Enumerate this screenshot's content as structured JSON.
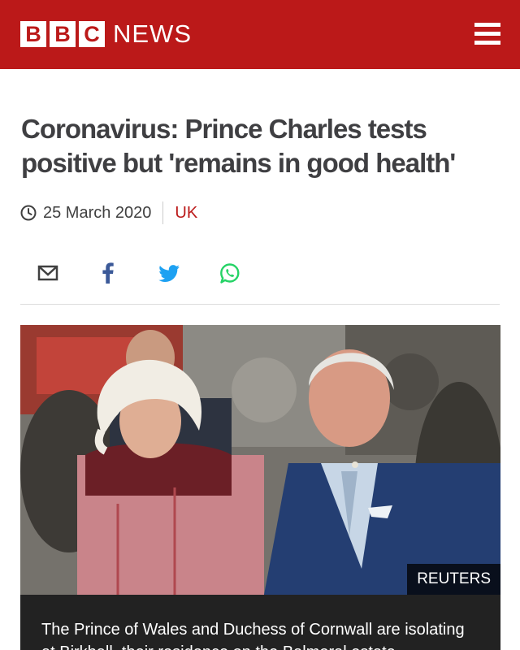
{
  "header": {
    "logo_letters": [
      "B",
      "B",
      "C"
    ],
    "logo_word": "NEWS",
    "menu_icon": "hamburger-menu-icon",
    "brand_color": "#bb1919"
  },
  "article": {
    "headline": "Coronavirus: Prince Charles tests positive but 'remains in good health'",
    "date": "25 March 2020",
    "date_icon": "clock-icon",
    "section": "UK",
    "headline_color": "#3f3f42"
  },
  "share": {
    "items": [
      {
        "name": "email",
        "icon": "email-icon",
        "color": "#404040"
      },
      {
        "name": "facebook",
        "icon": "facebook-icon",
        "color": "#3b5998"
      },
      {
        "name": "twitter",
        "icon": "twitter-icon",
        "color": "#1da1f2"
      },
      {
        "name": "whatsapp",
        "icon": "whatsapp-icon",
        "color": "#25d366"
      }
    ]
  },
  "image": {
    "credit": "REUTERS",
    "caption": "The Prince of Wales and Duchess of Cornwall are isolating at Birkhall, their residence on the Balmoral estate"
  }
}
